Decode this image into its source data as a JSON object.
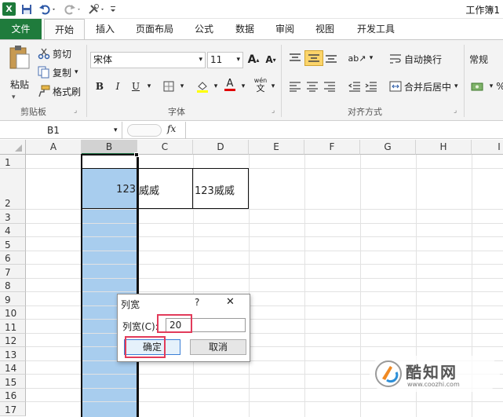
{
  "app": {
    "icon_letter": "X",
    "title": "工作簿1"
  },
  "tabs": [
    "文件",
    "开始",
    "插入",
    "页面布局",
    "公式",
    "数据",
    "审阅",
    "视图",
    "开发工具"
  ],
  "clipboard": {
    "paste": "粘贴",
    "cut": "剪切",
    "copy": "复制",
    "format_painter": "格式刷",
    "group_label": "剪贴板"
  },
  "font": {
    "name": "宋体",
    "size": "11",
    "group_label": "字体"
  },
  "alignment": {
    "wrap_text": "自动换行",
    "merge_center": "合并后居中",
    "group_label": "对齐方式"
  },
  "number": {
    "format": "常规"
  },
  "formula_bar": {
    "name_box": "B1",
    "fx": "fx"
  },
  "columns": [
    "A",
    "B",
    "C",
    "D",
    "E",
    "F",
    "G",
    "H",
    "I"
  ],
  "rows": [
    "1",
    "2",
    "3",
    "4",
    "5",
    "6",
    "7",
    "8",
    "9",
    "10",
    "11",
    "12",
    "13",
    "14",
    "15",
    "16",
    "17"
  ],
  "cells": {
    "B2": "123",
    "C2": "威威",
    "D2": "123威威"
  },
  "dialog": {
    "title": "列宽",
    "help": "?",
    "close": "✕",
    "field_label": "列宽(C):",
    "field_value": "20",
    "ok": "确定",
    "cancel": "取消"
  },
  "watermark": {
    "brand": "酷知网",
    "url": "www.coozhi.com"
  },
  "colors": {
    "file_tab": "#1f7b3c",
    "selection": "#a8cdee",
    "highlight": "#e23b5a"
  }
}
